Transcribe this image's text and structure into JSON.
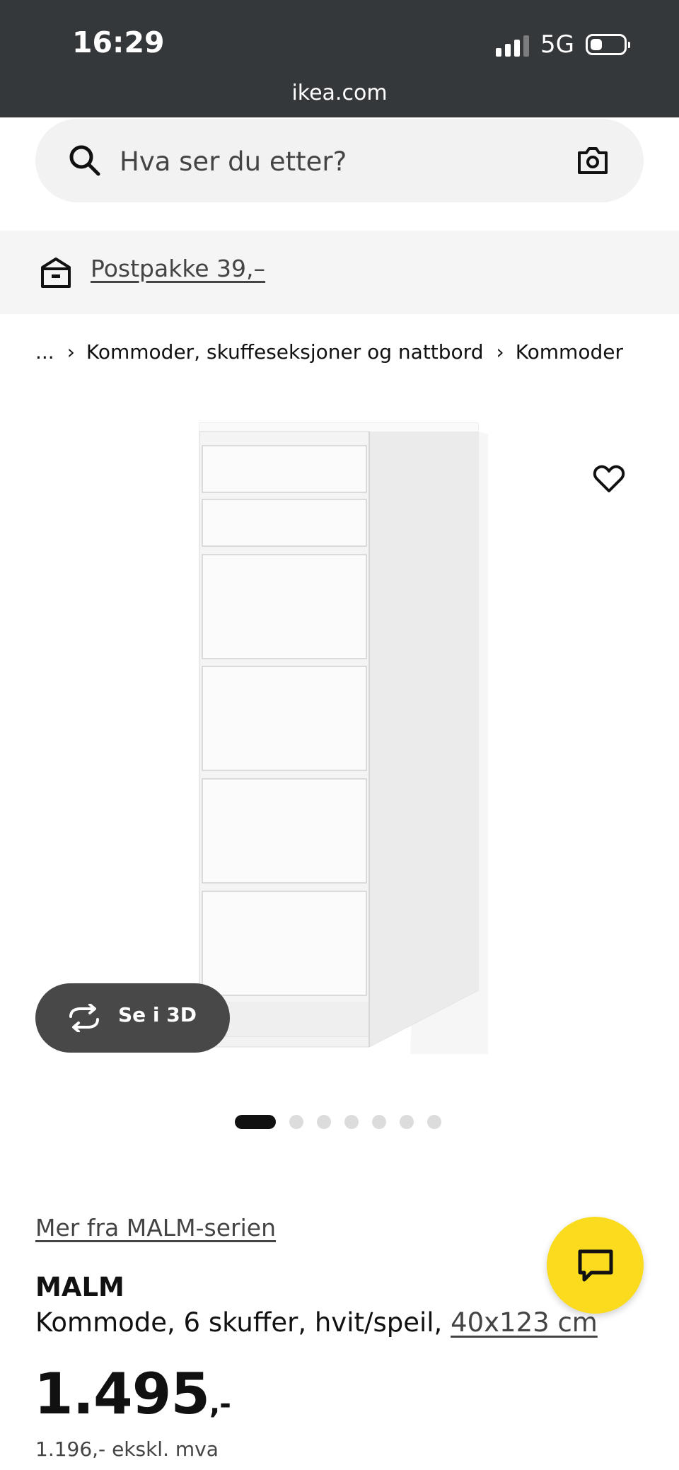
{
  "status_bar": {
    "time": "16:29",
    "network": "5G",
    "signal_bars_active": 3,
    "signal_bars_total": 4,
    "battery_level": 0.35
  },
  "browser": {
    "url": "ikea.com"
  },
  "search": {
    "placeholder": "Hva ser du etter?",
    "value": ""
  },
  "shipping": {
    "label": "Postpakke 39,–"
  },
  "breadcrumb": {
    "ellipsis": "...",
    "items": [
      "Kommoder, skuffeseksjoner og nattbord",
      "Kommoder"
    ]
  },
  "gallery": {
    "view3d_label": "Se i 3D",
    "image_count": 7,
    "active_index": 0
  },
  "product": {
    "series_link": "Mer fra MALM-serien",
    "name": "MALM",
    "description": "Kommode, 6 skuffer, hvit/speil,",
    "size_link": "40x123 cm",
    "price_main": "1.495",
    "price_suffix": ",-",
    "price_ex_vat": "1.196,- ekskl. mva"
  },
  "colors": {
    "status_bar_bg": "#35383b",
    "chat_button": "#fadb1e",
    "view3d_button": "#484848",
    "active_dot": "#111111",
    "inactive_dot": "#dcdcdc"
  },
  "icons": {
    "search": "search-icon",
    "camera": "camera-icon",
    "shipping": "package-icon",
    "favourite": "heart-icon",
    "view3d": "rotate-3d-icon",
    "chat": "chat-bubble-icon"
  }
}
